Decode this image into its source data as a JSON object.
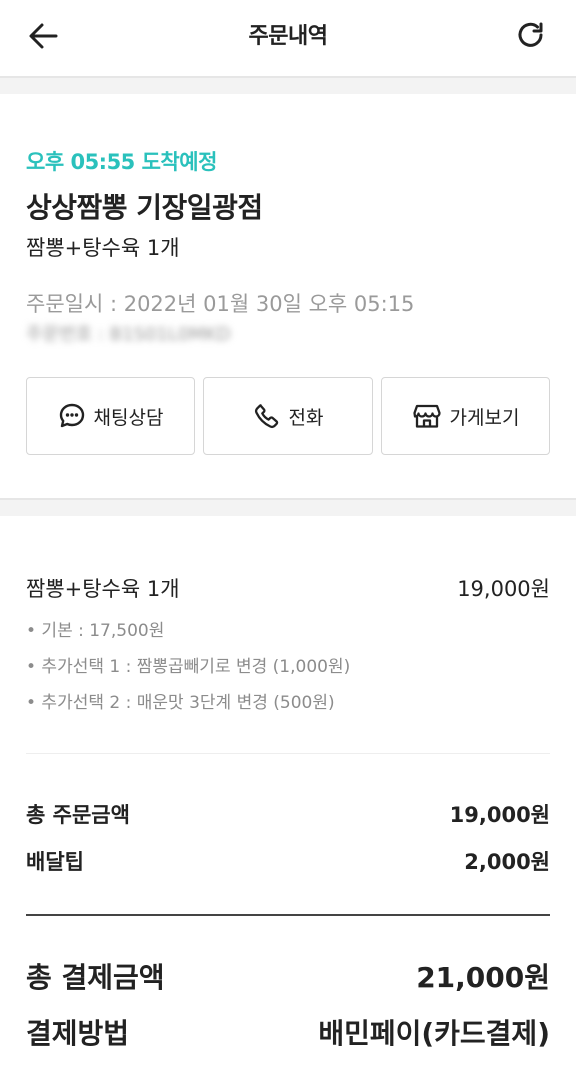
{
  "header": {
    "title": "주문내역",
    "back_icon": "arrow-left-icon",
    "refresh_icon": "refresh-icon"
  },
  "order": {
    "eta": "오후 05:55 도착예정",
    "store_name": "상상짬뽕 기장일광점",
    "summary": "짬뽕+탕수육 1개",
    "ordered_at": "주문일시 : 2022년 01월 30일 오후 05:15",
    "order_number": "주문번호 : B1S01L0MKD",
    "accent_color": "#2ac1bc"
  },
  "actions": {
    "chat": {
      "label": "채팅상담",
      "icon": "chat-bubble-icon"
    },
    "call": {
      "label": "전화",
      "icon": "phone-icon"
    },
    "store": {
      "label": "가게보기",
      "icon": "store-icon"
    }
  },
  "item": {
    "name": "짬뽕+탕수육 1개",
    "price": "19,000원",
    "options": [
      "• 기본 : 17,500원",
      "• 추가선택 1 : 짬뽕곱빼기로 변경 (1,000원)",
      "• 추가선택 2 : 매운맛 3단계 변경 (500원)"
    ]
  },
  "totals": {
    "order_total_label": "총 주문금액",
    "order_total_value": "19,000원",
    "delivery_tip_label": "배달팁",
    "delivery_tip_value": "2,000원",
    "payment_total_label": "총 결제금액",
    "payment_total_value": "21,000원",
    "payment_method_label": "결제방법",
    "payment_method_value": "배민페이(카드결제)"
  }
}
